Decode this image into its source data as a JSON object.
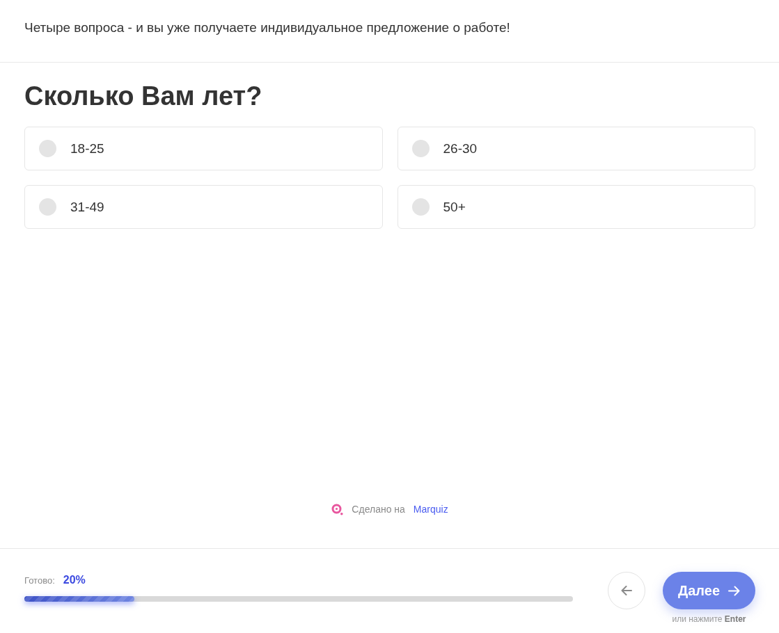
{
  "header": {
    "text": "Четыре вопроса - и вы уже получаете индивидуальное предложение о работе!"
  },
  "question": {
    "title": "Сколько Вам лет?",
    "options": [
      {
        "label": "18-25",
        "selected": false
      },
      {
        "label": "26-30",
        "selected": false
      },
      {
        "label": "31-49",
        "selected": false
      },
      {
        "label": "50+",
        "selected": false
      }
    ]
  },
  "branding": {
    "prefix": "Сделано на",
    "link": "Marquiz"
  },
  "progress": {
    "label": "Готово:",
    "value": "20%",
    "level": 0.2
  },
  "navigation": {
    "next": "Далее",
    "hint": "или нажмите **Enter**"
  }
}
